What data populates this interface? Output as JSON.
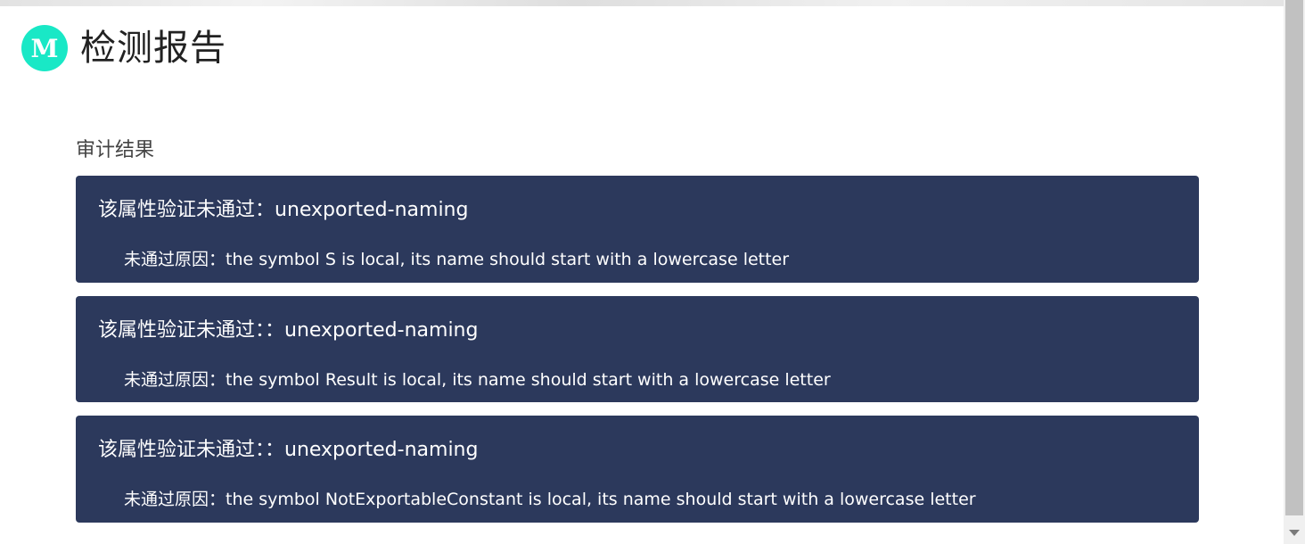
{
  "header": {
    "logo_letter": "M",
    "title": "检测报告",
    "logo_color": "#19e8c6"
  },
  "section": {
    "title": "审计结果"
  },
  "results": [
    {
      "heading": "该属性验证未通过：unexported-naming",
      "reason": "未通过原因：the symbol S is local, its name should start with a lowercase letter"
    },
    {
      "heading": "该属性验证未通过：：unexported-naming",
      "reason": "未通过原因：the symbol Result is local, its name should start with a lowercase letter"
    },
    {
      "heading": "该属性验证未通过：：unexported-naming",
      "reason": "未通过原因：the symbol NotExportableConstant is local, its name should start with a lowercase letter"
    }
  ],
  "colors": {
    "card_background": "#2c395c",
    "text_on_card": "#ffffff"
  }
}
